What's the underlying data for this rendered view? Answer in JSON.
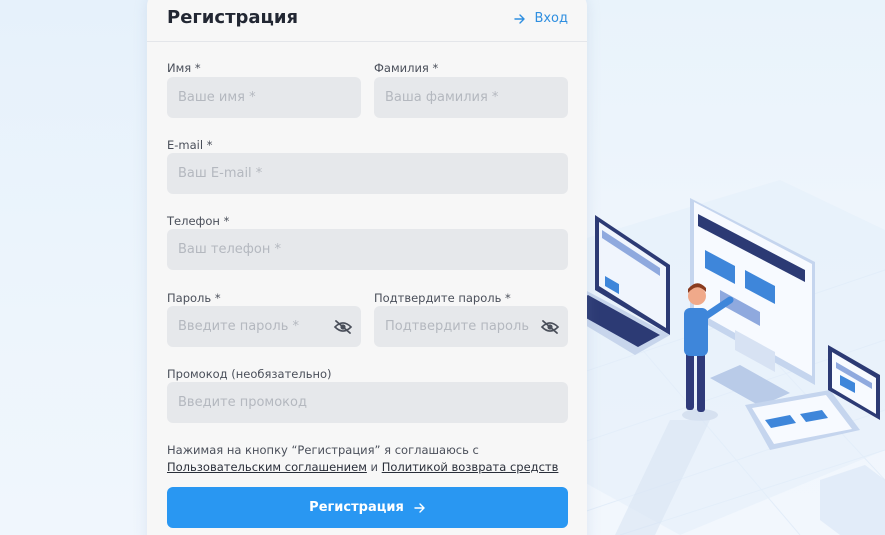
{
  "header": {
    "title": "Регистрация",
    "login_label": "Вход"
  },
  "form": {
    "first_name": {
      "label": "Имя *",
      "placeholder": "Ваше имя *"
    },
    "last_name": {
      "label": "Фамилия *",
      "placeholder": "Ваша фамилия *"
    },
    "email": {
      "label": "E-mail *",
      "placeholder": "Ваш E-mail *"
    },
    "phone": {
      "label": "Телефон *",
      "placeholder": "Ваш телефон *"
    },
    "password": {
      "label": "Пароль *",
      "placeholder": "Введите пароль *"
    },
    "confirm_password": {
      "label": "Подтвердите пароль *",
      "placeholder": "Подтвердите пароль *"
    },
    "promo": {
      "label": "Промокод (необязательно)",
      "placeholder": "Введите промокод"
    }
  },
  "agreement": {
    "prefix": "Нажимая на кнопку “Регистрация” я соглашаюсь с ",
    "terms_link": "Пользовательским соглашением",
    "middle": " и ",
    "refund_link": "Политикой возврата средств"
  },
  "submit_label": "Регистрация",
  "icons": {
    "login": "arrow-right-icon",
    "password_toggle": "eye-off-icon",
    "submit": "arrow-right-icon"
  },
  "colors": {
    "accent": "#2997f2",
    "link": "#2f8fe0",
    "input_bg": "#e6e8eb",
    "card_bg": "#f7f7f7"
  }
}
